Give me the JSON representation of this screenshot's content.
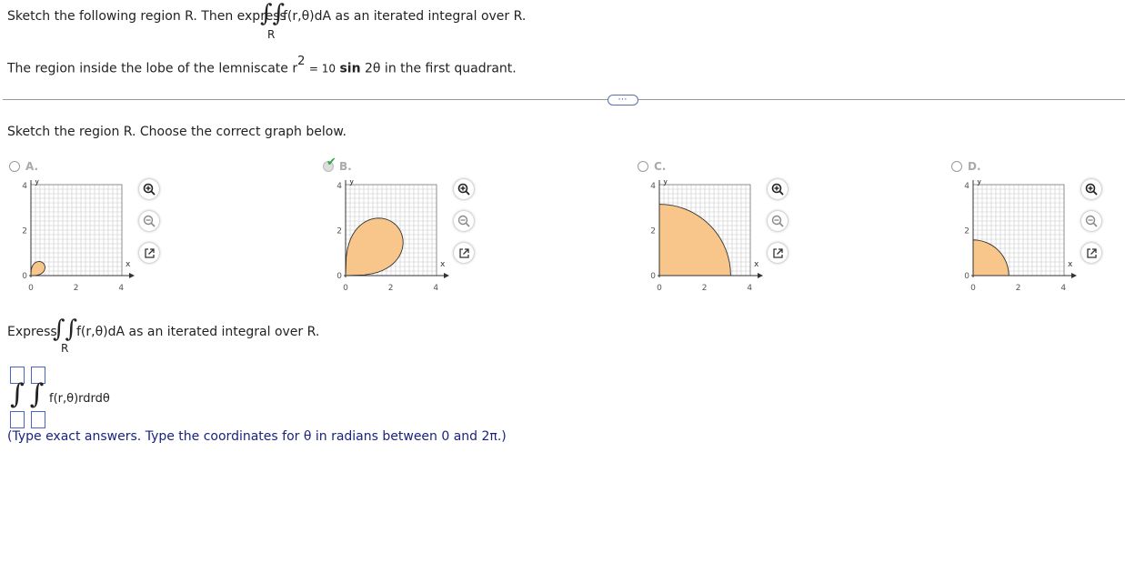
{
  "question": {
    "intro_before": "Sketch the following region R. Then express",
    "intro_after": "f(r,θ)dA as an iterated integral over R.",
    "region_letter": "R",
    "region_prefix": "The region inside the lobe of the lemniscate r",
    "exponent": "2",
    "eq_mid": "= 10",
    "sin_word": "sin",
    "eq_end": "2θ in the first quadrant."
  },
  "more_button": "⋯",
  "part1": {
    "prompt": "Sketch the region R. Choose the correct graph below.",
    "selected": "B",
    "options": [
      {
        "label": "A.",
        "lemniscate_a2": 0.6
      },
      {
        "label": "B.",
        "lemniscate_a2": 10
      },
      {
        "label": "C.",
        "lemniscate_a2": 10,
        "shape_note": "quarter disk"
      },
      {
        "label": "D.",
        "lemniscate_a2": 2.5,
        "shape_note": "quarter disk"
      }
    ],
    "axis": {
      "x_label": "x",
      "y_label": "y",
      "x_ticks": [
        "0",
        "2",
        "4"
      ],
      "y_ticks": [
        "0",
        "2",
        "4"
      ],
      "range": [
        0,
        4.5
      ],
      "fill_color": "#f8c68a"
    }
  },
  "part2": {
    "express_before": "Express",
    "express_after": "f(r,θ)dA as an iterated integral over R.",
    "region_letter": "R",
    "integrand": "f(r,θ)rdrdθ",
    "hint": "(Type exact answers. Type the coordinates for θ in radians between 0 and 2π.)"
  }
}
